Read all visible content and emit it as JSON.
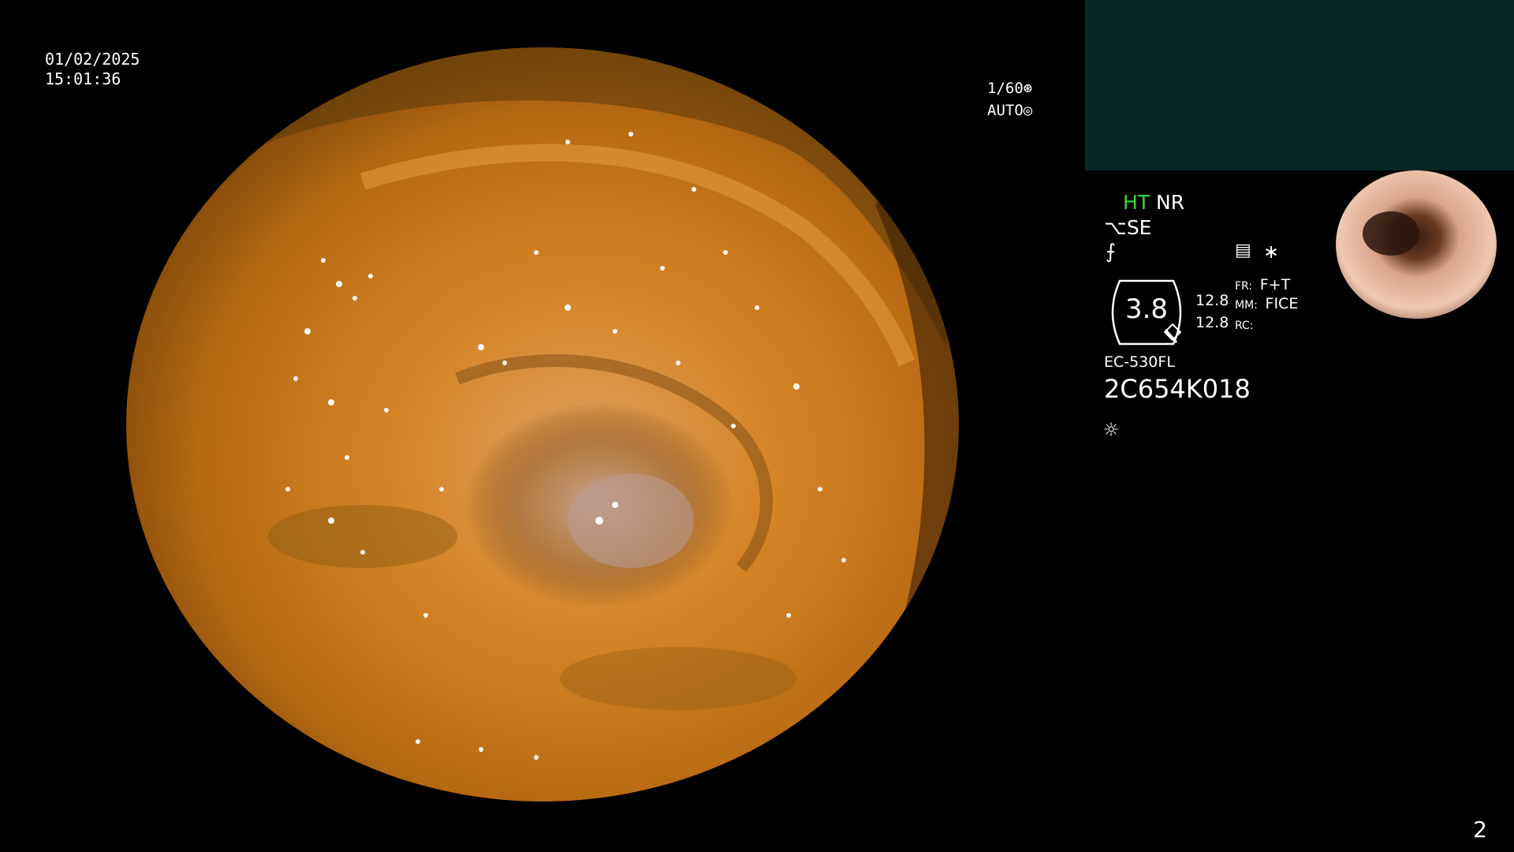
{
  "overlay": {
    "date": "01/02/2025",
    "time": "15:01:36",
    "shutter": "1/60",
    "exposure": "AUTO"
  },
  "status": {
    "ht": "HT",
    "nr": "NR",
    "se": "SE",
    "ring_value": "3.8",
    "val1": "12.8",
    "val2": "12.8",
    "fr_label": "FR:",
    "fr_value": "F+T",
    "mm_label": "MM:",
    "mm_value": "FICE",
    "rc_label": "RC:",
    "model": "EC-530FL",
    "serial": "2C654K018"
  },
  "footer": {
    "page_number": "2"
  },
  "colors": {
    "aux_panel": "#062827",
    "ht_green": "#36d83a",
    "tissue_base": "#c9741b"
  },
  "icons": [
    "shutter-icon",
    "auto-exposure-icon",
    "se-icon",
    "f-icon",
    "menu-icon",
    "asterisk-icon",
    "brightness-icon"
  ]
}
